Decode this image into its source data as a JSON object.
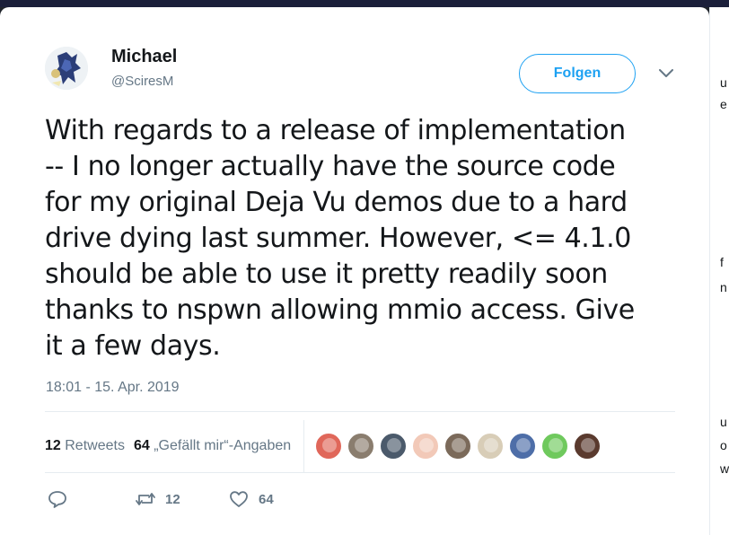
{
  "user": {
    "name": "Michael",
    "handle": "@SciresM"
  },
  "follow_button": {
    "label": "Folgen"
  },
  "tweet": {
    "lines": [
      "With regards to a release of implementation",
      "-- I no longer actually have the source code",
      "for my original Deja Vu demos due to a hard",
      "drive dying last summer. However, <= 4.1.0",
      "should be able to use it pretty readily soon",
      "thanks to nspwn allowing mmio access. Give",
      "it a few days."
    ],
    "timestamp": "18:01 - 15. Apr. 2019"
  },
  "stats": {
    "retweets_count": "12",
    "retweets_label": "Retweets",
    "likes_count": "64",
    "likes_label": "„Gefällt mir“-Angaben"
  },
  "likers": [
    {
      "name": "liker-1",
      "color": "#e0675a"
    },
    {
      "name": "liker-2",
      "color": "#8a7d6e"
    },
    {
      "name": "liker-3",
      "color": "#4b5a6b"
    },
    {
      "name": "liker-4",
      "color": "#f2c9b8"
    },
    {
      "name": "liker-5",
      "color": "#7b6a5a"
    },
    {
      "name": "liker-6",
      "color": "#d8cdb7"
    },
    {
      "name": "liker-7",
      "color": "#4e6ea8"
    },
    {
      "name": "liker-8",
      "color": "#6fc95d"
    },
    {
      "name": "liker-9",
      "color": "#5a3a2e"
    }
  ],
  "actions": {
    "reply_icon": "reply-icon",
    "retweet_count": "12",
    "like_count": "64"
  },
  "colors": {
    "accent": "#1da1f2",
    "text": "#14171a",
    "muted": "#657786",
    "border": "#e6ecf0"
  }
}
